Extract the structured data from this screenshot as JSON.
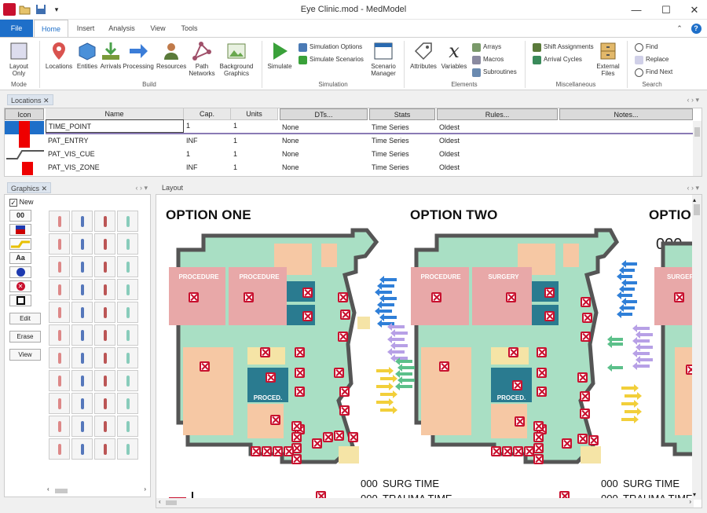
{
  "window": {
    "title": "Eye Clinic.mod - MedModel"
  },
  "quick_access": [
    "app-icon",
    "open-icon",
    "save-icon",
    "dropdown-icon"
  ],
  "tabs": [
    "File",
    "Home",
    "Insert",
    "Analysis",
    "View",
    "Tools"
  ],
  "ribbon": {
    "groups": {
      "mode": "Mode",
      "build": "Build",
      "simulation": "Simulation",
      "elements": "Elements",
      "misc": "Miscellaneous",
      "search": "Search"
    },
    "layout_only": "Layout Only",
    "locations": "Locations",
    "entities": "Entities",
    "arrivals": "Arrivals",
    "processing": "Processing",
    "resources": "Resources",
    "path_networks": "Path Networks",
    "background_graphics": "Background Graphics",
    "simulate": "Simulate",
    "simulation_options": "Simulation Options",
    "simulate_scenarios": "Simulate Scenarios",
    "scenario_manager": "Scenario Manager",
    "attributes": "Attributes",
    "variables": "Variables",
    "arrays": "Arrays",
    "macros": "Macros",
    "subroutines": "Subroutines",
    "shift_assignments": "Shift Assignments",
    "arrival_cycles": "Arrival Cycles",
    "external_files": "External Files",
    "find": "Find",
    "replace": "Replace",
    "find_next": "Find Next"
  },
  "locations_pane": {
    "title": "Locations",
    "columns": [
      "Icon",
      "Name",
      "Cap.",
      "Units",
      "DTs...",
      "Stats",
      "Rules...",
      "Notes..."
    ],
    "rows": [
      {
        "name": "TIME_POINT",
        "cap": "1",
        "units": "1",
        "dts": "None",
        "stats": "Time Series",
        "rules": "Oldest",
        "notes": ""
      },
      {
        "name": "PAT_ENTRY",
        "cap": "INF",
        "units": "1",
        "dts": "None",
        "stats": "Time Series",
        "rules": "Oldest",
        "notes": ""
      },
      {
        "name": "PAT_VIS_CUE",
        "cap": "1",
        "units": "1",
        "dts": "None",
        "stats": "Time Series",
        "rules": "Oldest",
        "notes": ""
      },
      {
        "name": "PAT_VIS_ZONE",
        "cap": "INF",
        "units": "1",
        "dts": "None",
        "stats": "Time Series",
        "rules": "Oldest",
        "notes": ""
      }
    ]
  },
  "graphics_pane": {
    "title": "Graphics",
    "new_label": "New",
    "new_checked": true,
    "counter_tool": "00",
    "text_tool": "Aa",
    "edit": "Edit",
    "erase": "Erase",
    "view": "View"
  },
  "layout_pane": {
    "title": "Layout",
    "option_one": "OPTION ONE",
    "option_two": "OPTION TWO",
    "option_three": "OPTIO",
    "counter": "000",
    "rooms": {
      "procedure": "PROCEDURE",
      "surgery": "SURGERY",
      "surger": "SURGER",
      "proced": "PROCED."
    },
    "footer": {
      "surg_time": "SURG TIME",
      "trauma_time": "TRAUMA TIME",
      "counter": "000"
    }
  },
  "colors": {
    "accent": "#1e6fc9",
    "room_pink": "#e8a8a8",
    "floor_green": "#a9dfc4",
    "wall": "#555555",
    "teal": "#2a7b90",
    "peach": "#f6c8a4",
    "yellow": "#f5e4a6",
    "x_red": "#c8102e"
  }
}
